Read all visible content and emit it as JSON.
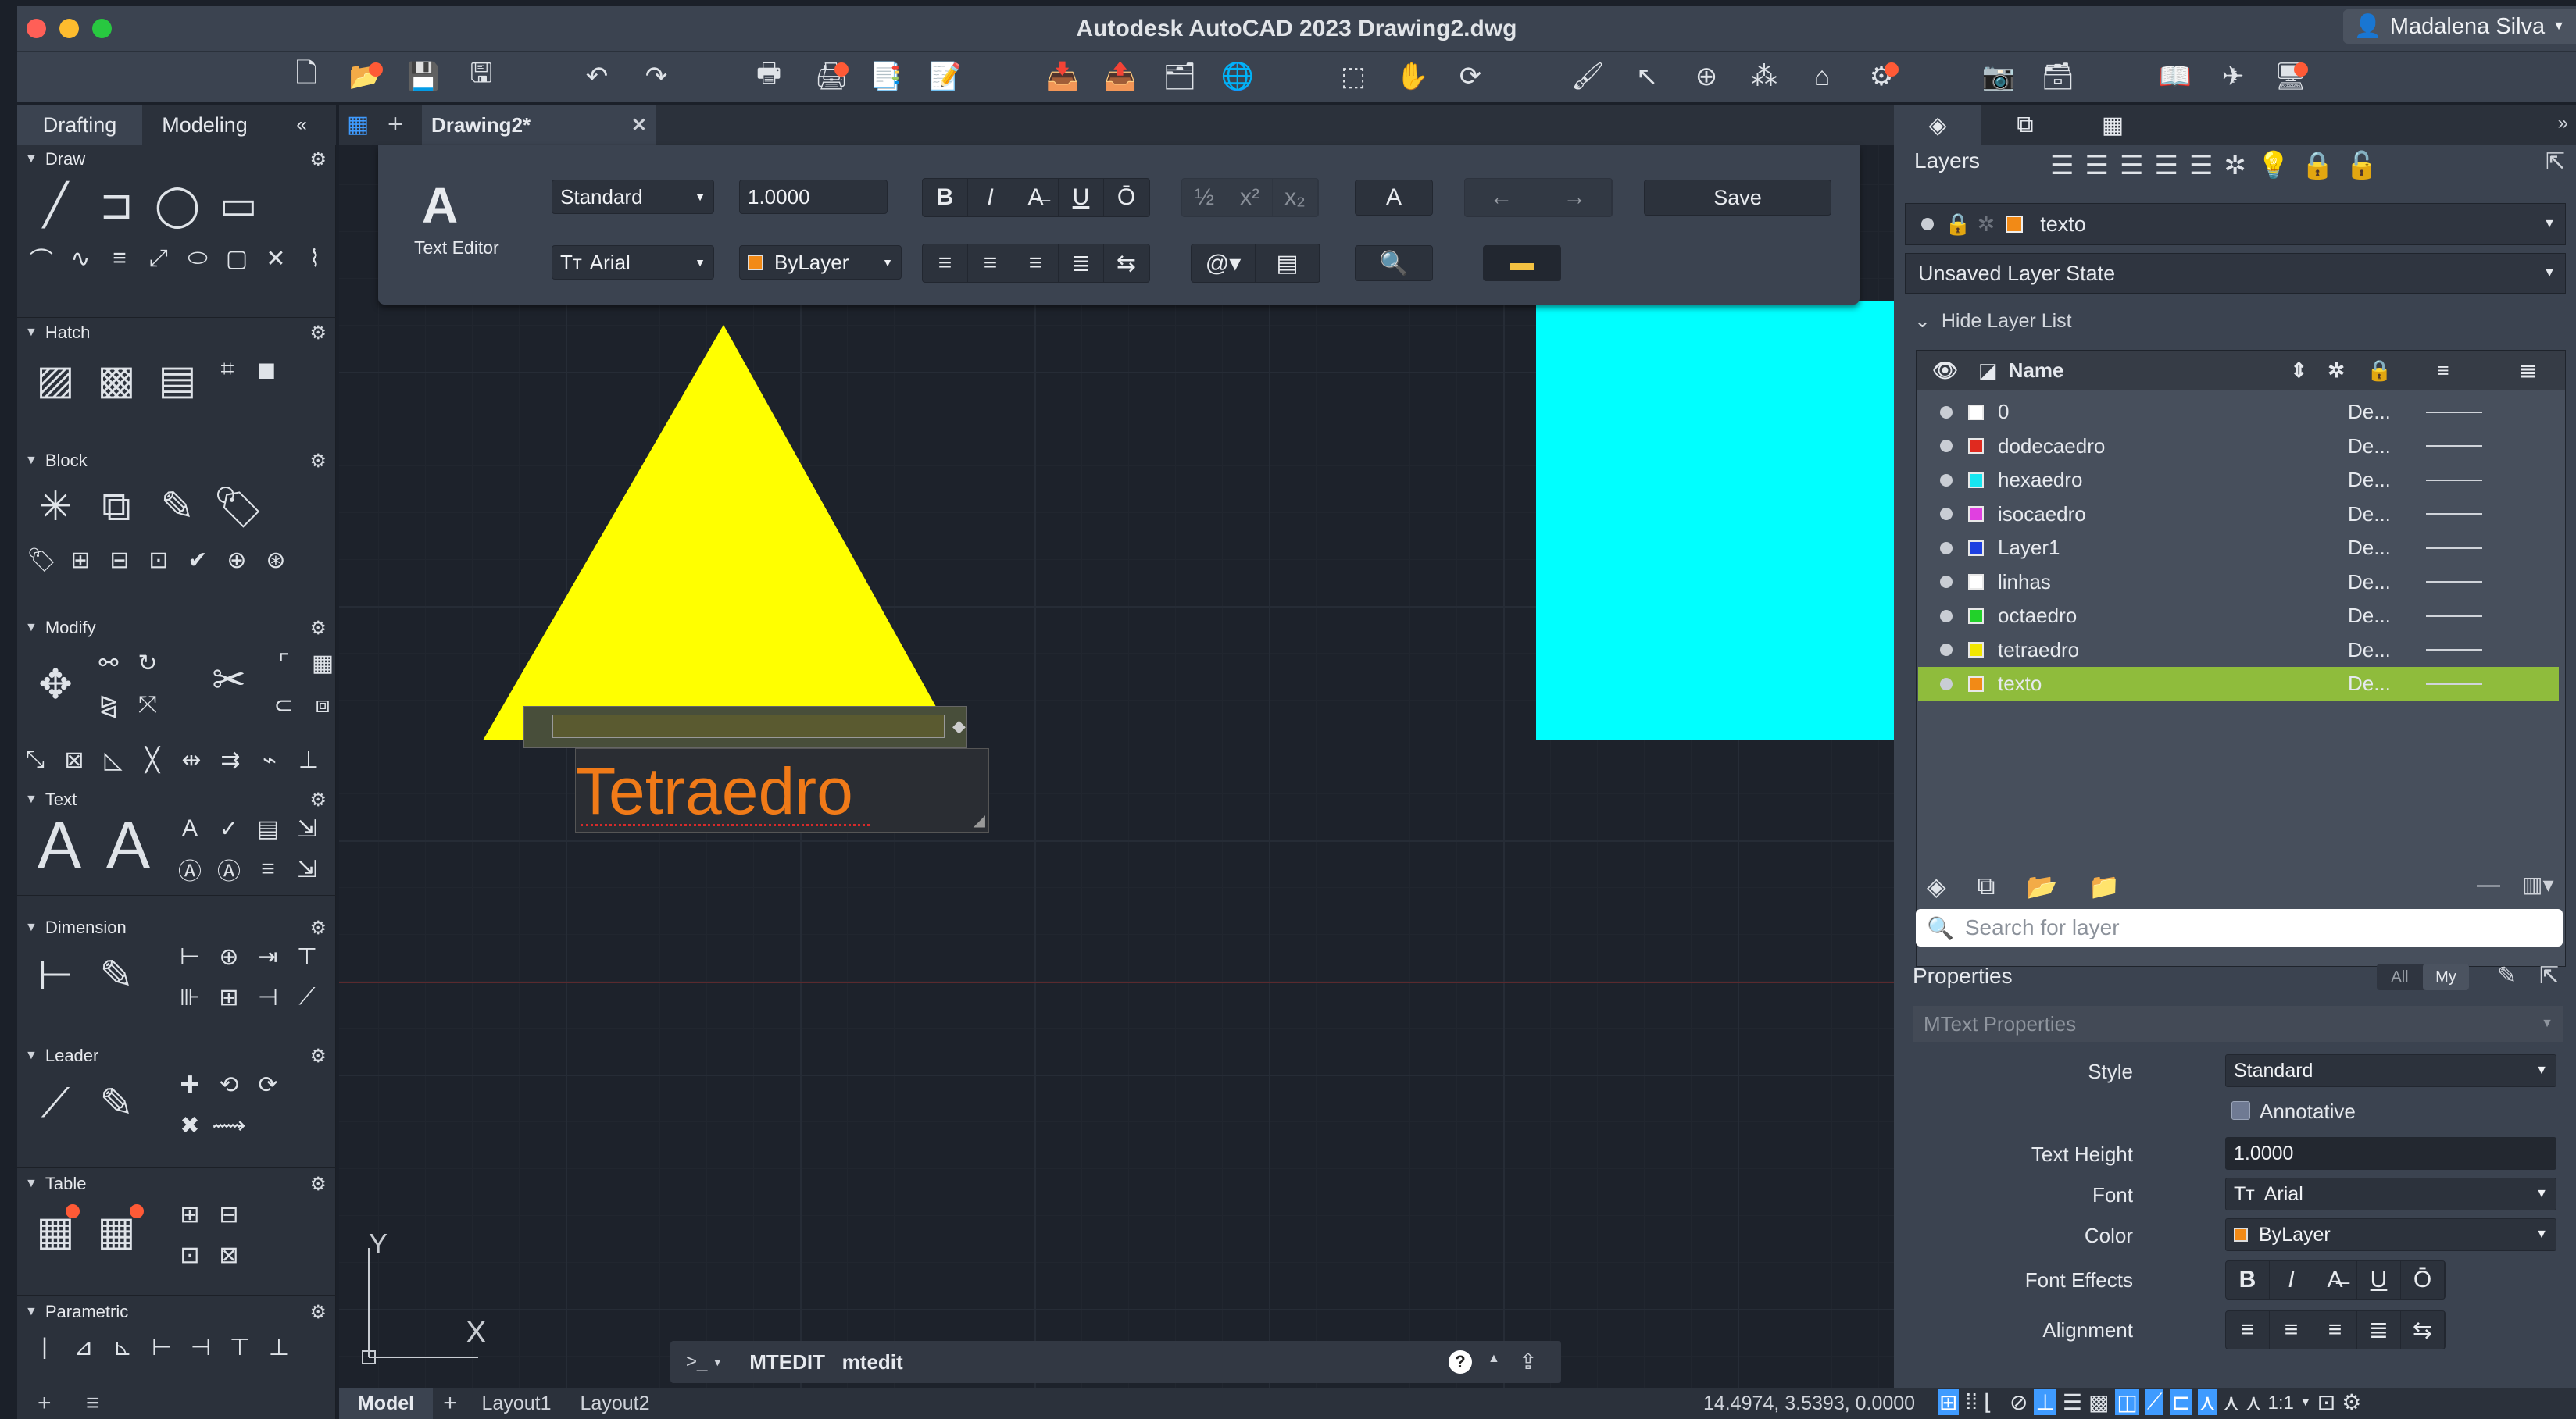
{
  "window": {
    "title": "Autodesk AutoCAD 2023   Drawing2.dwg",
    "user": "Madalena Silva"
  },
  "palette": {
    "tabs": [
      "Drafting",
      "Modeling"
    ],
    "sections": [
      "Draw",
      "Hatch",
      "Block",
      "Modify",
      "Text",
      "Dimension",
      "Leader",
      "Table",
      "Parametric"
    ]
  },
  "document": {
    "tab": "Drawing2*"
  },
  "text_editor": {
    "label": "Text Editor",
    "style": "Standard",
    "height": "1.0000",
    "font": "Arial",
    "color": "ByLayer",
    "save": "Save"
  },
  "canvas": {
    "mtext": "Tetraedro",
    "ucs_x": "X",
    "ucs_y": "Y"
  },
  "command_line": {
    "prompt": ">_",
    "text": "MTEDIT _mtedit"
  },
  "layers": {
    "title": "Layers",
    "current_layer": "texto",
    "layer_state": "Unsaved Layer State",
    "hide_list": "Hide Layer List",
    "col_name": "Name",
    "search_placeholder": "Search for layer",
    "rows": [
      {
        "name": "0",
        "color": "#ffffff",
        "linetype": "De..."
      },
      {
        "name": "dodecaedro",
        "color": "#e02a1f",
        "linetype": "De..."
      },
      {
        "name": "hexaedro",
        "color": "#16e6f0",
        "linetype": "De..."
      },
      {
        "name": "isocaedro",
        "color": "#e040e0",
        "linetype": "De..."
      },
      {
        "name": "Layer1",
        "color": "#1d3fe0",
        "linetype": "De..."
      },
      {
        "name": "linhas",
        "color": "#ffffff",
        "linetype": "De..."
      },
      {
        "name": "octaedro",
        "color": "#22d12a",
        "linetype": "De..."
      },
      {
        "name": "tetraedro",
        "color": "#f2e600",
        "linetype": "De..."
      },
      {
        "name": "texto",
        "color": "#f28a16",
        "linetype": "De..."
      }
    ]
  },
  "properties": {
    "title": "Properties",
    "filter_all": "All",
    "filter_my": "My",
    "object_type": "MText Properties",
    "style_label": "Style",
    "style_value": "Standard",
    "annotative_label": "Annotative",
    "text_height_label": "Text Height",
    "text_height_value": "1.0000",
    "font_label": "Font",
    "font_value": "Arial",
    "color_label": "Color",
    "color_value": "ByLayer",
    "font_effects_label": "Font Effects",
    "alignment_label": "Alignment"
  },
  "status": {
    "tabs": [
      "Model",
      "Layout1",
      "Layout2"
    ],
    "coords": "14.4974, 3.5393, 0.0000",
    "scale": "1:1"
  },
  "colors": {
    "accent_selected": "#8fbc3c",
    "triangle": "#ffff00",
    "cube": "#00ffff",
    "mtext": "#f07a18"
  }
}
